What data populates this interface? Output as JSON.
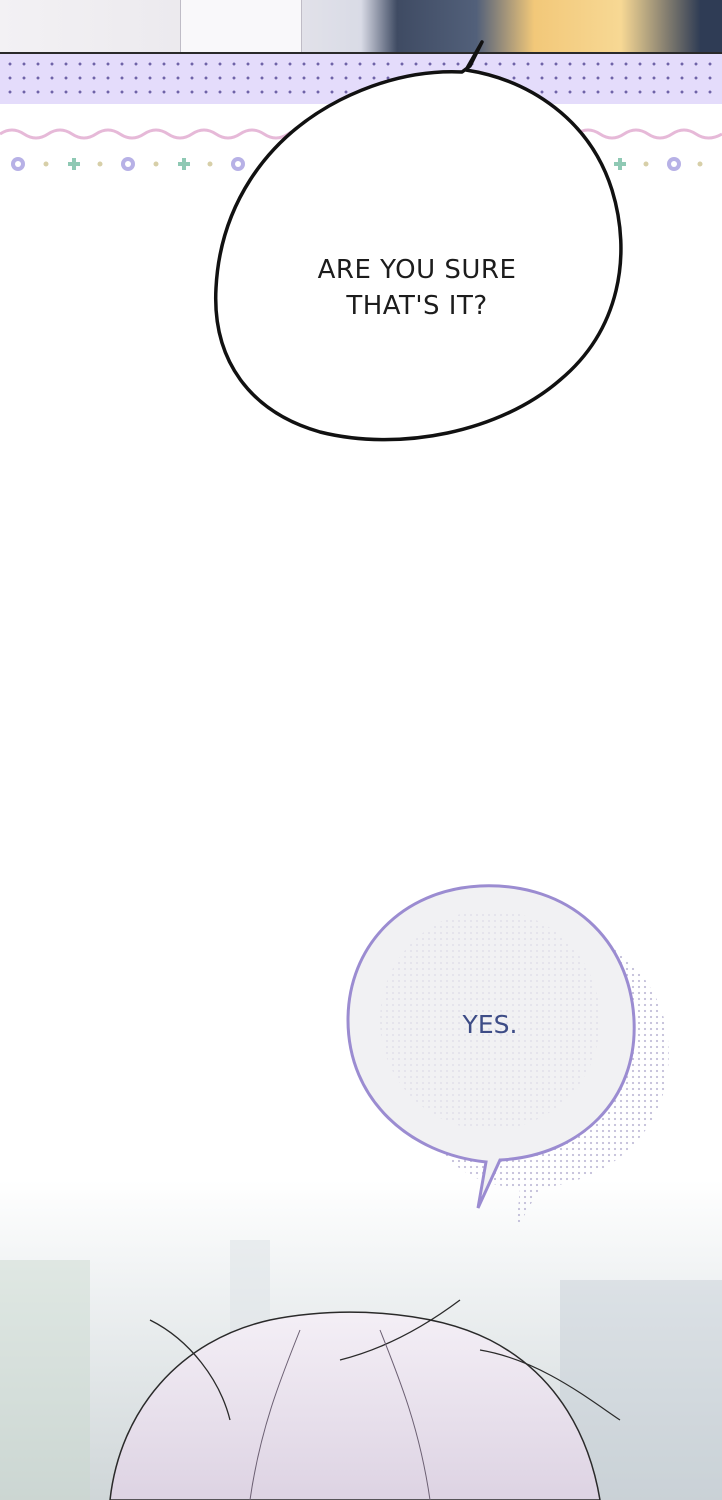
{
  "bubbles": {
    "first": {
      "line1": "ARE YOU SURE",
      "line2": "THAT'S IT?"
    },
    "second": {
      "text": "YES."
    }
  },
  "colors": {
    "dot_band": "#e4dcfb",
    "dot": "#6f63a8",
    "bubble_outline_dark": "#111111",
    "bubble_outline_lavender": "#9b8cd1",
    "second_text": "#3d4c86",
    "hair": "#e9e2ee"
  }
}
